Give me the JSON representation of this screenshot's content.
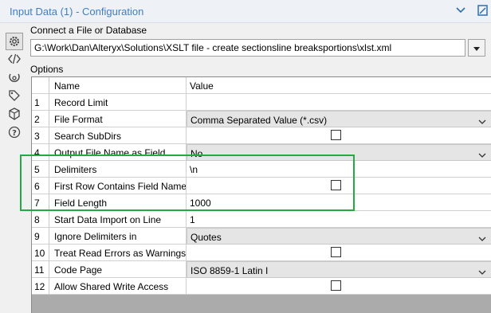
{
  "header": {
    "title": "Input Data (1) - Configuration"
  },
  "sidebar": {
    "icons": [
      "gear-icon",
      "xml-code-icon",
      "eye-icon",
      "tag-icon",
      "cube-icon",
      "help-icon"
    ]
  },
  "connect": {
    "label": "Connect a File or Database",
    "path": "G:\\Work\\Dan\\Alteryx\\Solutions\\XSLT file - create sectionsline breaksportions\\xlst.xml"
  },
  "options": {
    "label": "Options",
    "columns": {
      "name": "Name",
      "value": "Value"
    },
    "rows": [
      {
        "num": "1",
        "name": "Record Limit",
        "type": "text",
        "value": ""
      },
      {
        "num": "2",
        "name": "File Format",
        "type": "combo",
        "value": "Comma Separated Value (*.csv)"
      },
      {
        "num": "3",
        "name": "Search SubDirs",
        "type": "checkbox",
        "value": ""
      },
      {
        "num": "4",
        "name": "Output File Name as Field",
        "type": "combo",
        "value": "No"
      },
      {
        "num": "5",
        "name": "Delimiters",
        "type": "text",
        "value": "\\n"
      },
      {
        "num": "6",
        "name": "First Row Contains Field Names",
        "type": "checkbox",
        "value": ""
      },
      {
        "num": "7",
        "name": "Field Length",
        "type": "text",
        "value": "1000"
      },
      {
        "num": "8",
        "name": "Start Data Import on Line",
        "type": "text",
        "value": "1"
      },
      {
        "num": "9",
        "name": "Ignore Delimiters in",
        "type": "combo",
        "value": "Quotes"
      },
      {
        "num": "10",
        "name": "Treat Read Errors as Warnings",
        "type": "checkbox",
        "value": ""
      },
      {
        "num": "11",
        "name": "Code Page",
        "type": "combo",
        "value": "ISO 8859-1 Latin I"
      },
      {
        "num": "12",
        "name": "Allow Shared Write Access",
        "type": "checkbox",
        "value": ""
      }
    ]
  },
  "colors": {
    "title_text": "#3f7fbf",
    "highlight_box": "#22aa44"
  }
}
